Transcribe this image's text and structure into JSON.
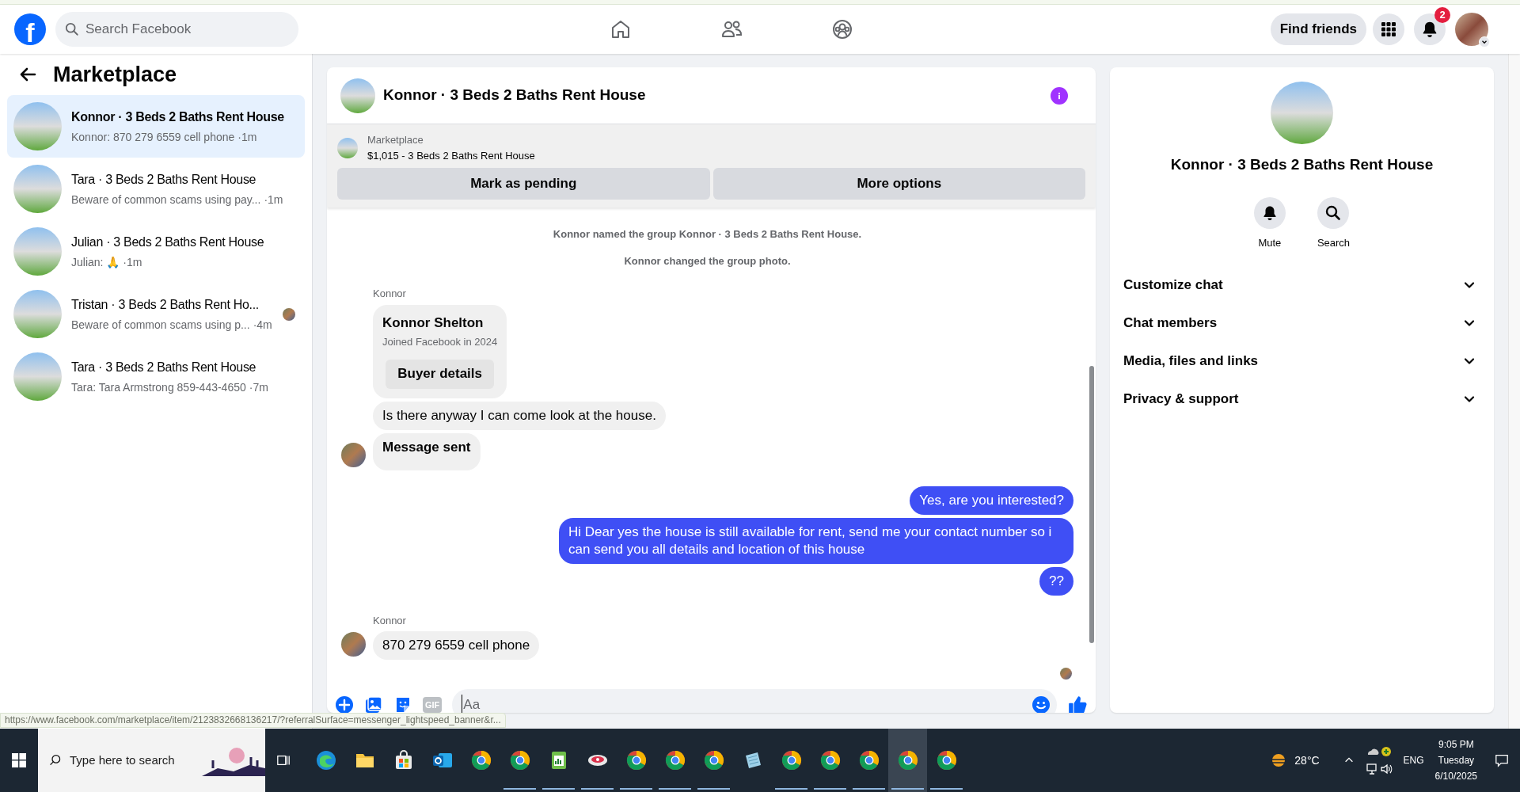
{
  "topbar": {
    "logo": "f",
    "search_placeholder": "Search Facebook",
    "find_friends": "Find friends",
    "notification_count": "2"
  },
  "sidebar": {
    "title": "Marketplace",
    "conversations": [
      {
        "title": "Konnor · 3 Beds 2 Baths Rent House",
        "preview": "Konnor: 870 279 6559 cell phone",
        "time": "·1m",
        "selected": true,
        "read_receipt": false
      },
      {
        "title": "Tara · 3 Beds 2 Baths Rent House",
        "preview": "Beware of common scams using pay...",
        "time": "·1m",
        "selected": false,
        "read_receipt": false
      },
      {
        "title": "Julian · 3 Beds 2 Baths Rent House",
        "preview": "Julian: 🙏",
        "time": "·1m",
        "selected": false,
        "read_receipt": false
      },
      {
        "title": "Tristan · 3 Beds 2 Baths Rent Ho...",
        "preview": "Beware of common scams using p...",
        "time": "·4m",
        "selected": false,
        "read_receipt": true
      },
      {
        "title": "Tara · 3 Beds 2 Baths Rent House",
        "preview": "Tara: Tara Armstrong 859-443-4650",
        "time": "·7m",
        "selected": false,
        "read_receipt": false
      }
    ]
  },
  "chat": {
    "title": "Konnor · 3 Beds 2 Baths Rent House",
    "listing": {
      "label": "Marketplace",
      "title": "$1,015 - 3 Beds 2 Baths Rent House"
    },
    "listing_buttons": [
      "Mark as pending",
      "More options"
    ],
    "events": [
      "Konnor named the group Konnor · 3 Beds 2 Baths Rent House.",
      "Konnor changed the group photo."
    ],
    "messages": [
      {
        "kind": "card",
        "sender": "Konnor",
        "name": "Konnor Shelton",
        "subtitle": "Joined Facebook in 2024",
        "button": "Buyer details",
        "avatar": false
      },
      {
        "kind": "incoming",
        "text": "Is there anyway I can come look at the house.",
        "bold": false,
        "avatar": false
      },
      {
        "kind": "incoming",
        "text": "Message sent",
        "bold": true,
        "avatar": true
      },
      {
        "kind": "outgoing",
        "text": "Yes, are you interested?"
      },
      {
        "kind": "outgoing",
        "text": "Hi Dear yes the house is still available for rent, send me your contact number so i can send you all details and location of this house"
      },
      {
        "kind": "outgoing",
        "text": "??"
      },
      {
        "kind": "incoming",
        "sender": "Konnor",
        "text": "870 279 6559 cell phone",
        "bold": false,
        "avatar": true
      }
    ],
    "composer": {
      "gif_label": "GIF",
      "placeholder": "Aa"
    }
  },
  "details": {
    "title": "Konnor · 3 Beds 2 Baths Rent House",
    "actions": [
      {
        "kind": "mute",
        "label": "Mute"
      },
      {
        "kind": "search",
        "label": "Search"
      }
    ],
    "sections": [
      {
        "label": "Customize chat",
        "expanded": false
      },
      {
        "label": "Chat members",
        "expanded": false
      },
      {
        "label": "Media, files and links",
        "expanded": false
      },
      {
        "label": "Privacy & support",
        "expanded": false
      }
    ]
  },
  "status_url": "https://www.facebook.com/marketplace/item/2123832668136217/?referralSurface=messenger_lightspeed_banner&r...",
  "taskbar": {
    "search_placeholder": "Type here to search",
    "apps": [
      {
        "kind": "edge",
        "running": false,
        "selected": false
      },
      {
        "kind": "folder",
        "running": false,
        "selected": false
      },
      {
        "kind": "store",
        "running": false,
        "selected": false
      },
      {
        "kind": "mail",
        "running": false,
        "selected": false
      },
      {
        "kind": "chrome",
        "running": false,
        "selected": false
      },
      {
        "kind": "chrome",
        "running": true,
        "selected": false
      },
      {
        "kind": "sheet",
        "running": true,
        "selected": false
      },
      {
        "kind": "disc",
        "running": true,
        "selected": false
      },
      {
        "kind": "chrome",
        "running": true,
        "selected": false
      },
      {
        "kind": "chrome",
        "running": true,
        "selected": false
      },
      {
        "kind": "chrome",
        "running": true,
        "selected": false
      },
      {
        "kind": "notes",
        "running": false,
        "selected": false
      },
      {
        "kind": "chrome",
        "running": true,
        "selected": false
      },
      {
        "kind": "chrome",
        "running": true,
        "selected": false
      },
      {
        "kind": "chrome",
        "running": true,
        "selected": false
      },
      {
        "kind": "chrome",
        "running": true,
        "selected": true
      },
      {
        "kind": "chrome",
        "running": true,
        "selected": false
      }
    ],
    "weather": "28°C",
    "language": "ENG",
    "time": "9:05 PM",
    "day": "Tuesday",
    "date": "6/10/2025"
  }
}
